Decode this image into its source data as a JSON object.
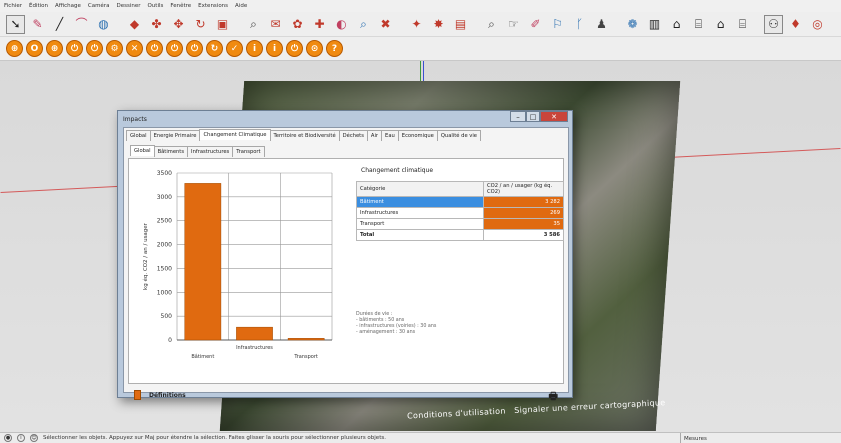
{
  "menu": [
    "Fichier",
    "Édition",
    "Affichage",
    "Caméra",
    "Dessiner",
    "Outils",
    "Fenêtre",
    "Extensions",
    "Aide"
  ],
  "toolbar1_icons": [
    "select-arrow",
    "eraser",
    "line",
    "arc",
    "shape",
    "paint",
    "push-pull",
    "move",
    "rotate",
    "offset",
    "tape-measure",
    "text",
    "dimension",
    "protractor",
    "orbit",
    "pan",
    "zoom",
    "zoom-extents",
    "component",
    "style",
    "layer",
    "search",
    "walk",
    "position-camera",
    "section",
    "axes",
    "warehouse",
    "extension",
    "house",
    "home",
    "front-view",
    "back-view",
    "sketchup-logo",
    "ruby",
    "globe"
  ],
  "toolbar2_icons": [
    "plug",
    "o",
    "plug",
    "power",
    "power",
    "gear",
    "x",
    "power",
    "power",
    "power",
    "check",
    "info",
    "info",
    "power",
    "lock",
    "check",
    "question"
  ],
  "dialog": {
    "title": "Impacts",
    "tabs": [
      "Global",
      "Energie Primaire",
      "Changement Climatique",
      "Territoire et Biodiversité",
      "Déchets",
      "Air",
      "Eau",
      "Economique",
      "Qualité de vie"
    ],
    "selected_tab": "Changement Climatique",
    "subtabs": [
      "Global",
      "Bâtiments",
      "Infrastructures",
      "Transport"
    ],
    "selected_subtab": "Global",
    "table_title": "Changement climatique",
    "table": {
      "headers": [
        "Catégorie",
        "CO2 / an / usager (kg éq. CO2)"
      ],
      "rows": [
        {
          "cat": "Bâtiment",
          "val": "3 282"
        },
        {
          "cat": "Infrastructures",
          "val": "269"
        },
        {
          "cat": "Transport",
          "val": "35"
        }
      ],
      "total_label": "Total",
      "total_value": "3 586"
    },
    "note": [
      "Durées de vie :",
      "- bâtiments : 50 ans",
      "- infrastructures (voiries) : 30 ans",
      "- aménagement : 30 ans"
    ],
    "definitions_label": "Définitions"
  },
  "chart_data": {
    "type": "bar",
    "categories": [
      "Bâtiment",
      "Infrastructures",
      "Transport"
    ],
    "values": [
      3282,
      269,
      35
    ],
    "ylabel": "kg éq. CO2 / an / usager",
    "ylim": [
      0,
      3500
    ],
    "yticks": [
      "0",
      "500",
      "1000",
      "1500",
      "2000",
      "2500",
      "3000",
      "3500"
    ],
    "bar_color": "#e06a10",
    "grid": true
  },
  "map_label": {
    "text": "Conditions d'utilisation",
    "link": "Signaler une erreur cartographique"
  },
  "status": {
    "text": "Sélectionner les objets. Appuyez sur Maj pour étendre la sélection. Faites glisser la souris pour sélectionner plusieurs objets.",
    "measures_label": "Mesures"
  },
  "colors": {
    "accent": "#e06a10",
    "selection": "#3a8ee0",
    "dialog_frame": "#b9c9dc"
  }
}
